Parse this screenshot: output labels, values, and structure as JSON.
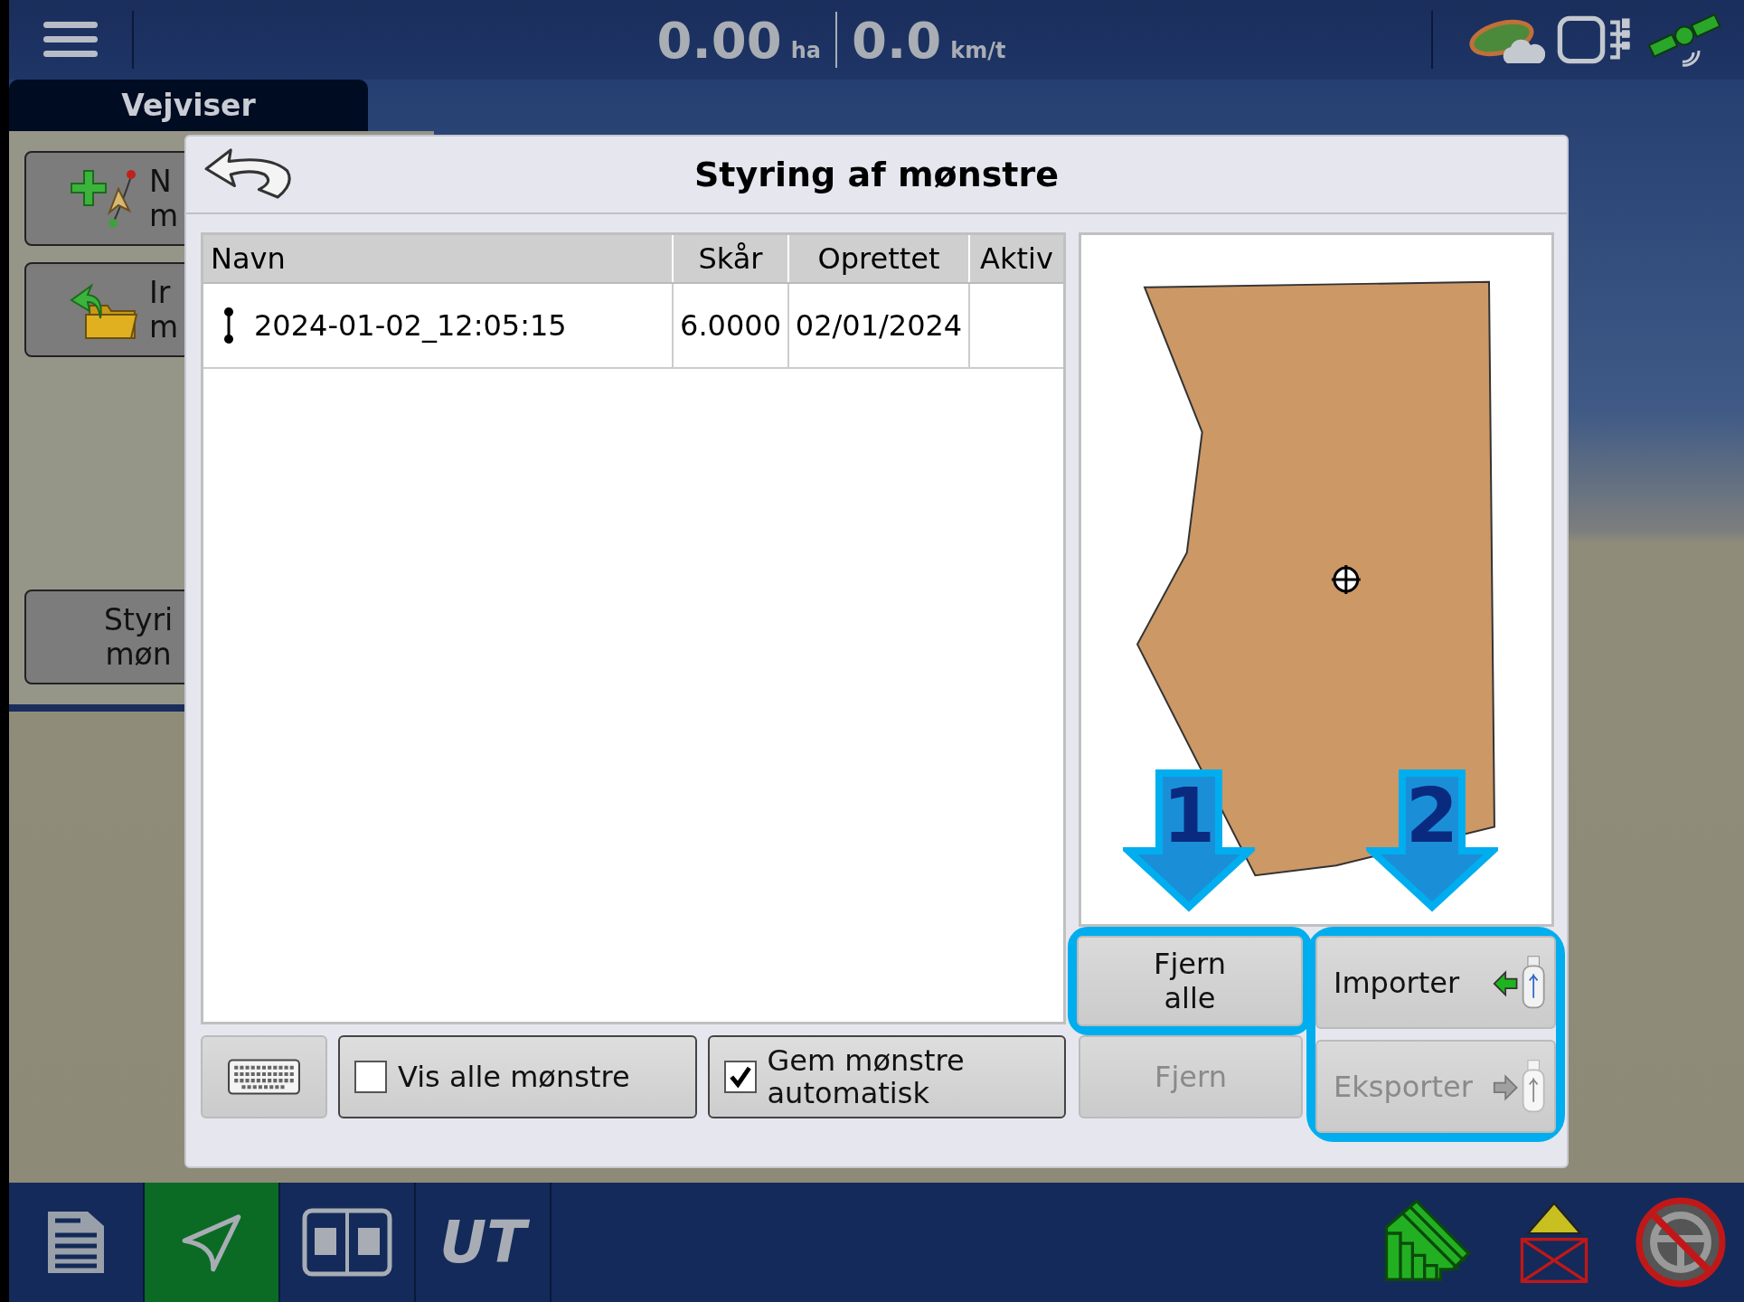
{
  "top_bar": {
    "area_value": "0.00",
    "area_unit": "ha",
    "speed_value": "0.0",
    "speed_unit": "km/t"
  },
  "tab": {
    "label": "Vejviser",
    "selected": true
  },
  "side_buttons": [
    {
      "kind": "new",
      "lines": [
        "N",
        "m"
      ]
    },
    {
      "kind": "import",
      "lines": [
        "Ir",
        "m"
      ]
    },
    {
      "kind": "manage",
      "lines": [
        "Styri",
        "møn"
      ]
    }
  ],
  "dialog": {
    "title": "Styring af mønstre",
    "table": {
      "columns": [
        "Navn",
        "Skår",
        "Oprettet",
        "Aktiv"
      ],
      "rows": [
        {
          "kind": "line",
          "name": "2024-01-02_12:05:15",
          "swath": "6.0000",
          "created": "02/01/2024",
          "selected": false
        }
      ]
    },
    "checkboxes": [
      {
        "label": "Vis alle mønstre",
        "checked": false
      },
      {
        "label": "Gem mønstre automatisk",
        "checked": true
      }
    ],
    "buttons": [
      {
        "kind": "remove_all",
        "label": "Fjern alle",
        "disabled": false
      },
      {
        "kind": "import",
        "label": "Importer",
        "disabled": false
      },
      {
        "kind": "remove",
        "label": "Fjern",
        "disabled": true
      },
      {
        "kind": "export",
        "label": "Eksporter",
        "disabled": true
      }
    ]
  },
  "annotations": [
    {
      "label": "1"
    },
    {
      "label": "2"
    }
  ],
  "bottom_bar": [
    {
      "kind": "doc",
      "selected": false
    },
    {
      "kind": "nav",
      "selected": true
    },
    {
      "kind": "split",
      "selected": false
    },
    {
      "kind": "ut",
      "label": "UT",
      "selected": false
    }
  ]
}
